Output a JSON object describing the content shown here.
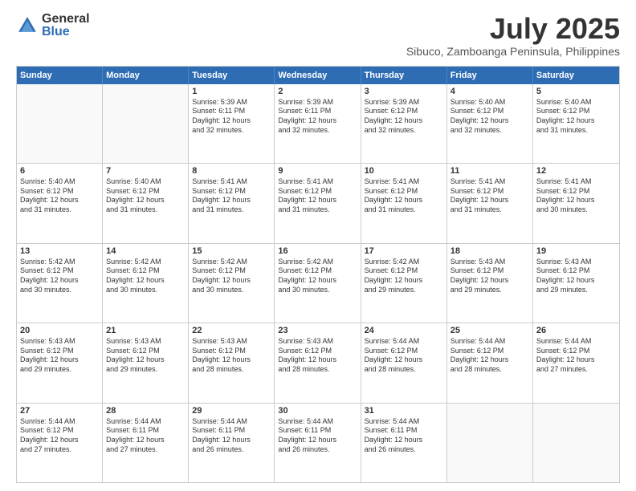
{
  "logo": {
    "general": "General",
    "blue": "Blue"
  },
  "title": "July 2025",
  "subtitle": "Sibuco, Zamboanga Peninsula, Philippines",
  "headers": [
    "Sunday",
    "Monday",
    "Tuesday",
    "Wednesday",
    "Thursday",
    "Friday",
    "Saturday"
  ],
  "weeks": [
    [
      {
        "day": "",
        "empty": true
      },
      {
        "day": "",
        "empty": true
      },
      {
        "day": "1",
        "lines": [
          "Sunrise: 5:39 AM",
          "Sunset: 6:11 PM",
          "Daylight: 12 hours",
          "and 32 minutes."
        ]
      },
      {
        "day": "2",
        "lines": [
          "Sunrise: 5:39 AM",
          "Sunset: 6:11 PM",
          "Daylight: 12 hours",
          "and 32 minutes."
        ]
      },
      {
        "day": "3",
        "lines": [
          "Sunrise: 5:39 AM",
          "Sunset: 6:12 PM",
          "Daylight: 12 hours",
          "and 32 minutes."
        ]
      },
      {
        "day": "4",
        "lines": [
          "Sunrise: 5:40 AM",
          "Sunset: 6:12 PM",
          "Daylight: 12 hours",
          "and 32 minutes."
        ]
      },
      {
        "day": "5",
        "lines": [
          "Sunrise: 5:40 AM",
          "Sunset: 6:12 PM",
          "Daylight: 12 hours",
          "and 31 minutes."
        ]
      }
    ],
    [
      {
        "day": "6",
        "lines": [
          "Sunrise: 5:40 AM",
          "Sunset: 6:12 PM",
          "Daylight: 12 hours",
          "and 31 minutes."
        ]
      },
      {
        "day": "7",
        "lines": [
          "Sunrise: 5:40 AM",
          "Sunset: 6:12 PM",
          "Daylight: 12 hours",
          "and 31 minutes."
        ]
      },
      {
        "day": "8",
        "lines": [
          "Sunrise: 5:41 AM",
          "Sunset: 6:12 PM",
          "Daylight: 12 hours",
          "and 31 minutes."
        ]
      },
      {
        "day": "9",
        "lines": [
          "Sunrise: 5:41 AM",
          "Sunset: 6:12 PM",
          "Daylight: 12 hours",
          "and 31 minutes."
        ]
      },
      {
        "day": "10",
        "lines": [
          "Sunrise: 5:41 AM",
          "Sunset: 6:12 PM",
          "Daylight: 12 hours",
          "and 31 minutes."
        ]
      },
      {
        "day": "11",
        "lines": [
          "Sunrise: 5:41 AM",
          "Sunset: 6:12 PM",
          "Daylight: 12 hours",
          "and 31 minutes."
        ]
      },
      {
        "day": "12",
        "lines": [
          "Sunrise: 5:41 AM",
          "Sunset: 6:12 PM",
          "Daylight: 12 hours",
          "and 30 minutes."
        ]
      }
    ],
    [
      {
        "day": "13",
        "lines": [
          "Sunrise: 5:42 AM",
          "Sunset: 6:12 PM",
          "Daylight: 12 hours",
          "and 30 minutes."
        ]
      },
      {
        "day": "14",
        "lines": [
          "Sunrise: 5:42 AM",
          "Sunset: 6:12 PM",
          "Daylight: 12 hours",
          "and 30 minutes."
        ]
      },
      {
        "day": "15",
        "lines": [
          "Sunrise: 5:42 AM",
          "Sunset: 6:12 PM",
          "Daylight: 12 hours",
          "and 30 minutes."
        ]
      },
      {
        "day": "16",
        "lines": [
          "Sunrise: 5:42 AM",
          "Sunset: 6:12 PM",
          "Daylight: 12 hours",
          "and 30 minutes."
        ]
      },
      {
        "day": "17",
        "lines": [
          "Sunrise: 5:42 AM",
          "Sunset: 6:12 PM",
          "Daylight: 12 hours",
          "and 29 minutes."
        ]
      },
      {
        "day": "18",
        "lines": [
          "Sunrise: 5:43 AM",
          "Sunset: 6:12 PM",
          "Daylight: 12 hours",
          "and 29 minutes."
        ]
      },
      {
        "day": "19",
        "lines": [
          "Sunrise: 5:43 AM",
          "Sunset: 6:12 PM",
          "Daylight: 12 hours",
          "and 29 minutes."
        ]
      }
    ],
    [
      {
        "day": "20",
        "lines": [
          "Sunrise: 5:43 AM",
          "Sunset: 6:12 PM",
          "Daylight: 12 hours",
          "and 29 minutes."
        ]
      },
      {
        "day": "21",
        "lines": [
          "Sunrise: 5:43 AM",
          "Sunset: 6:12 PM",
          "Daylight: 12 hours",
          "and 29 minutes."
        ]
      },
      {
        "day": "22",
        "lines": [
          "Sunrise: 5:43 AM",
          "Sunset: 6:12 PM",
          "Daylight: 12 hours",
          "and 28 minutes."
        ]
      },
      {
        "day": "23",
        "lines": [
          "Sunrise: 5:43 AM",
          "Sunset: 6:12 PM",
          "Daylight: 12 hours",
          "and 28 minutes."
        ]
      },
      {
        "day": "24",
        "lines": [
          "Sunrise: 5:44 AM",
          "Sunset: 6:12 PM",
          "Daylight: 12 hours",
          "and 28 minutes."
        ]
      },
      {
        "day": "25",
        "lines": [
          "Sunrise: 5:44 AM",
          "Sunset: 6:12 PM",
          "Daylight: 12 hours",
          "and 28 minutes."
        ]
      },
      {
        "day": "26",
        "lines": [
          "Sunrise: 5:44 AM",
          "Sunset: 6:12 PM",
          "Daylight: 12 hours",
          "and 27 minutes."
        ]
      }
    ],
    [
      {
        "day": "27",
        "lines": [
          "Sunrise: 5:44 AM",
          "Sunset: 6:12 PM",
          "Daylight: 12 hours",
          "and 27 minutes."
        ]
      },
      {
        "day": "28",
        "lines": [
          "Sunrise: 5:44 AM",
          "Sunset: 6:11 PM",
          "Daylight: 12 hours",
          "and 27 minutes."
        ]
      },
      {
        "day": "29",
        "lines": [
          "Sunrise: 5:44 AM",
          "Sunset: 6:11 PM",
          "Daylight: 12 hours",
          "and 26 minutes."
        ]
      },
      {
        "day": "30",
        "lines": [
          "Sunrise: 5:44 AM",
          "Sunset: 6:11 PM",
          "Daylight: 12 hours",
          "and 26 minutes."
        ]
      },
      {
        "day": "31",
        "lines": [
          "Sunrise: 5:44 AM",
          "Sunset: 6:11 PM",
          "Daylight: 12 hours",
          "and 26 minutes."
        ]
      },
      {
        "day": "",
        "empty": true
      },
      {
        "day": "",
        "empty": true
      }
    ]
  ]
}
